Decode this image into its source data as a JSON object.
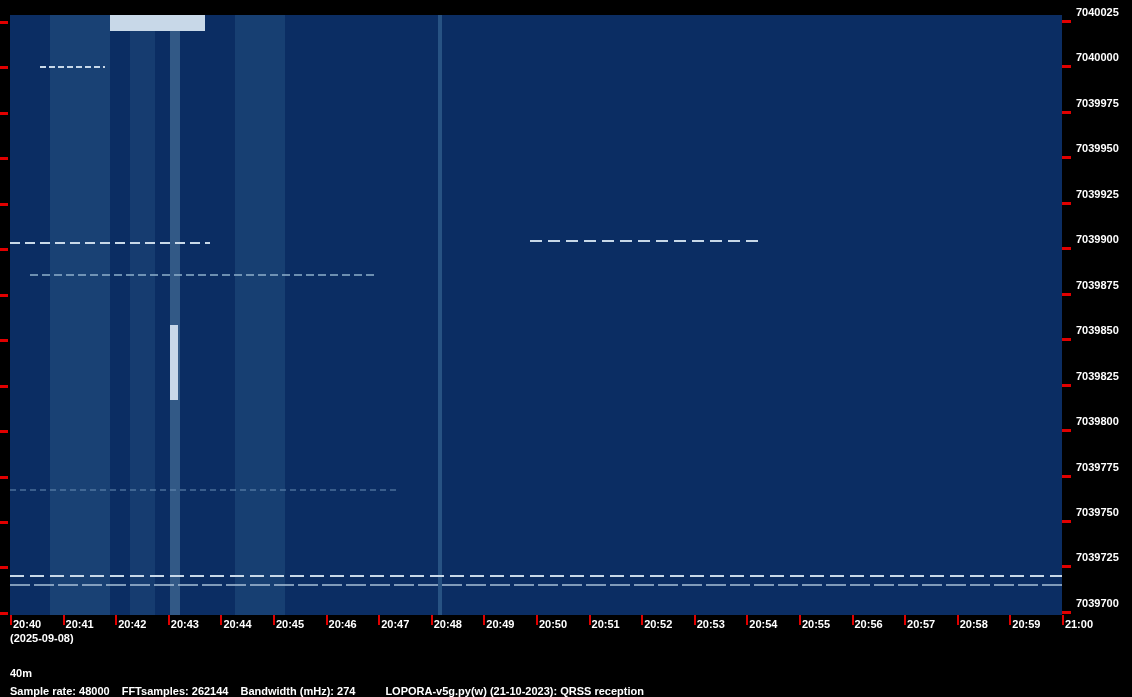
{
  "frequency_axis": {
    "labels": [
      "7040025",
      "7040000",
      "7039975",
      "7039950",
      "7039925",
      "7039900",
      "7039875",
      "7039850",
      "7039825",
      "7039800",
      "7039775",
      "7039750",
      "7039725",
      "7039700"
    ]
  },
  "time_axis": {
    "labels": [
      "20:40",
      "20:41",
      "20:42",
      "20:43",
      "20:44",
      "20:45",
      "20:46",
      "20:47",
      "20:48",
      "20:49",
      "20:50",
      "20:51",
      "20:52",
      "20:53",
      "20:54",
      "20:55",
      "20:56",
      "20:57",
      "20:58",
      "20:59",
      "21:00"
    ],
    "date": "(2025-09-08)"
  },
  "band": "40m",
  "info": [
    "Sample rate: 48000",
    "FFTsamples: 262144",
    "Bandwidth (mHz): 274",
    "LOPORA-v5g.py(w) (21-10-2023): QRSS reception"
  ]
}
